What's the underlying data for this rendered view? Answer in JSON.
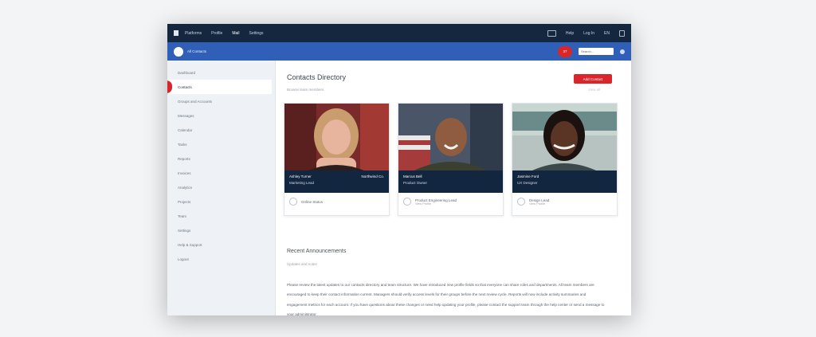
{
  "topnav": {
    "links": [
      "Platforms",
      "Profile",
      "Mail",
      "Settings"
    ],
    "right_items": [
      "Help",
      "Log In",
      "EN"
    ]
  },
  "bluebar": {
    "breadcrumb": "All Contacts",
    "notify_label": "37",
    "search_placeholder": "Search..."
  },
  "sidebar": {
    "items": [
      "Dashboard",
      "Contacts",
      "Groups and Accounts",
      "Messages",
      "Calendar",
      "Tasks",
      "Reports",
      "Invoices",
      "Analytics",
      "Projects",
      "Team",
      "Settings",
      "Help & Support",
      "Logout"
    ],
    "active_index": 1
  },
  "main": {
    "title": "Contacts Directory",
    "subtitle": "Browse team members",
    "new_button": "Add Contact",
    "right_hint": "View all",
    "cards": [
      {
        "name": "Ashley Turner",
        "role": "Marketing Lead",
        "company": "Northwind Co.",
        "footer": "Online Status",
        "footer_sub": "",
        "photo_colors": [
          "#7a2a2a",
          "#d94a3f",
          "#2a1e1e"
        ],
        "skin": "#e7b49e",
        "hair": "#c99d6d"
      },
      {
        "name": "Marcus Bell",
        "role": "Product Owner",
        "company": "",
        "footer": "Product Engineering Lead",
        "footer_sub": "View Profile",
        "photo_colors": [
          "#4a5668",
          "#a63b3b",
          "#2f3a4a"
        ],
        "skin": "#8f5c3f",
        "hair": "#2a1e18"
      },
      {
        "name": "Jasmine Ford",
        "role": "UX Designer",
        "company": "",
        "footer": "Design Lead",
        "footer_sub": "View Profile",
        "photo_colors": [
          "#6b8a8a",
          "#c8d6d2",
          "#3a4a4a"
        ],
        "skin": "#5a3526",
        "hair": "#1b1210"
      }
    ],
    "section_title": "Recent Announcements",
    "section_sub": "Updates and notes",
    "body_text": "Please review the latest updates to our contacts directory and team structure. We have introduced new profile fields so that everyone can share roles and departments. All team members are encouraged to keep their contact information current. Managers should verify access levels for their groups before the next review cycle. Reports will now include activity summaries and engagement metrics for each account. If you have questions about these changes or need help updating your profile, please contact the support team through the help center or send a message to your administrator."
  },
  "colors": {
    "topnav": "#14273f",
    "bluebar": "#2f5fb6",
    "accent": "#d9262a"
  }
}
